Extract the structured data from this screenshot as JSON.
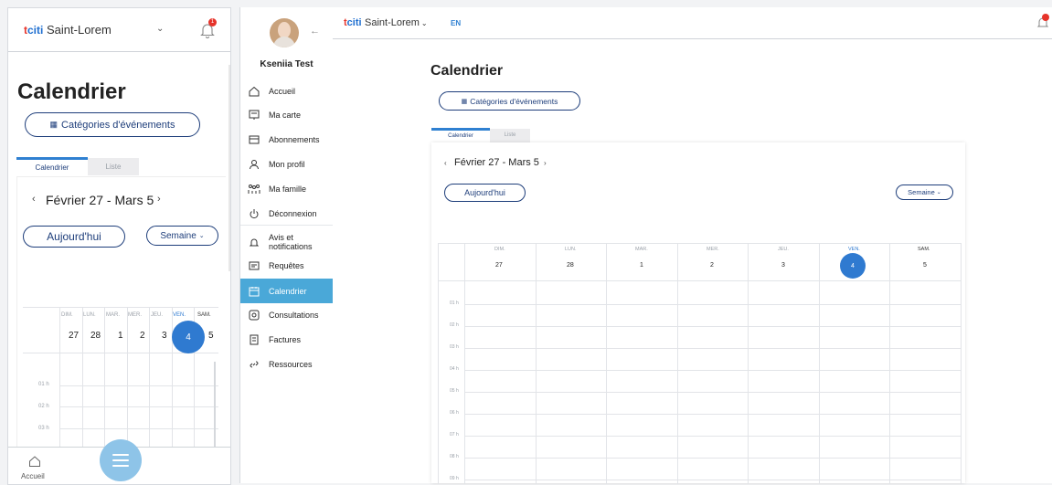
{
  "brand": {
    "logo_text": "citi",
    "logo_prefix": "t",
    "city": "Saint-Lorem"
  },
  "header": {
    "language": "EN",
    "notification_count": "1"
  },
  "page": {
    "title": "Calendrier",
    "categories_button": "Catégories d'événements"
  },
  "tabs": [
    {
      "label": "Calendrier",
      "active": true
    },
    {
      "label": "Liste",
      "active": false
    }
  ],
  "calendar": {
    "range_label": "Février 27 - Mars 5",
    "today_button": "Aujourd'hui",
    "view_button": "Semaine",
    "prev_arrow": "‹",
    "next_arrow": "›",
    "days": [
      {
        "abbr": "DIM.",
        "num": "27",
        "today": false
      },
      {
        "abbr": "LUN.",
        "num": "28",
        "today": false
      },
      {
        "abbr": "MAR.",
        "num": "1",
        "today": false
      },
      {
        "abbr": "MER.",
        "num": "2",
        "today": false
      },
      {
        "abbr": "JEU.",
        "num": "3",
        "today": false
      },
      {
        "abbr": "VEN.",
        "num": "4",
        "today": true
      },
      {
        "abbr": "SAM.",
        "num": "5",
        "today": false
      }
    ],
    "hours_desktop": [
      "01 h",
      "02 h",
      "03 h",
      "04 h",
      "05 h",
      "06 h",
      "07 h",
      "08 h",
      "09 h"
    ],
    "hours_mobile": [
      "01 h",
      "02 h",
      "03 h"
    ]
  },
  "user": {
    "name": "Kseniia Test"
  },
  "sidebar": {
    "items": [
      {
        "label": "Accueil",
        "icon": "home-icon"
      },
      {
        "label": "Ma carte",
        "icon": "card-icon"
      },
      {
        "label": "Abonnements",
        "icon": "subscriptions-icon"
      },
      {
        "label": "Mon profil",
        "icon": "profile-icon"
      },
      {
        "label": "Ma famille",
        "icon": "family-icon"
      },
      {
        "label": "Déconnexion",
        "icon": "power-icon"
      },
      {
        "label": "Avis et notifications",
        "icon": "bell-icon"
      },
      {
        "label": "Requêtes",
        "icon": "requests-icon"
      },
      {
        "label": "Calendrier",
        "icon": "calendar-icon",
        "active": true
      },
      {
        "label": "Consultations",
        "icon": "consultations-icon"
      },
      {
        "label": "Factures",
        "icon": "invoice-icon"
      },
      {
        "label": "Ressources",
        "icon": "link-icon"
      }
    ]
  },
  "mobile_bottom": {
    "home_label": "Accueil"
  },
  "colors": {
    "accent": "#2f7ad0",
    "nav_active": "#4aa8d8",
    "outline": "#1d3d7a",
    "badge": "#e6332a",
    "fab": "#8ec4e8"
  }
}
